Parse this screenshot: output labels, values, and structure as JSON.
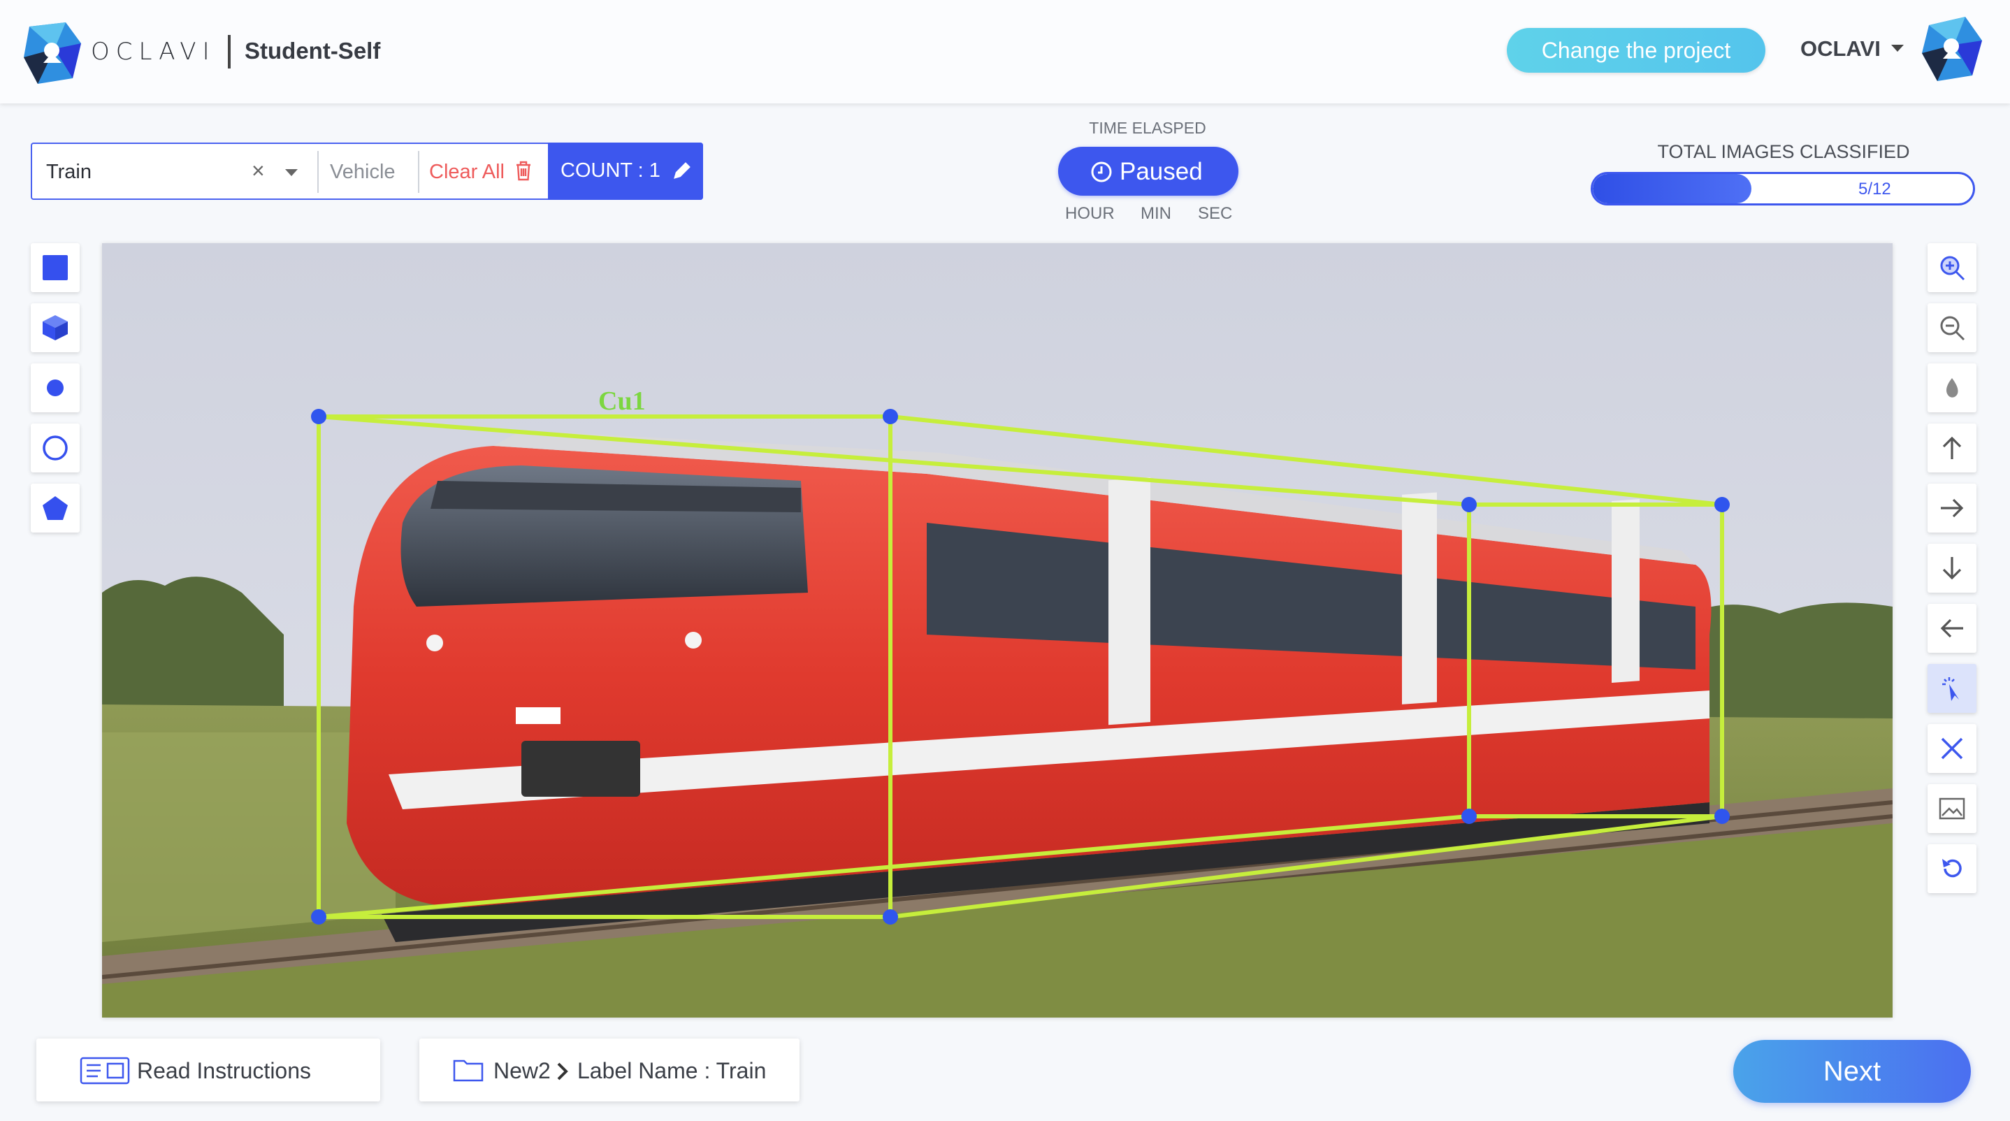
{
  "header": {
    "logo_text": "OCLAVI",
    "project_name": "Student-Self",
    "change_project_label": "Change the project",
    "user_name": "OCLAVI"
  },
  "label_bar": {
    "selected_label": "Train",
    "parent_label": "Vehicle",
    "clear_all_label": "Clear All",
    "count_label": "COUNT : 1"
  },
  "timer": {
    "title": "TIME ELASPED",
    "status": "Paused",
    "units": [
      "HOUR",
      "MIN",
      "SEC"
    ]
  },
  "progress": {
    "title": "TOTAL IMAGES CLASSIFIED",
    "text": "5/12",
    "fraction": 0.4167
  },
  "left_tools": [
    {
      "icon": "rectangle-tool-icon"
    },
    {
      "icon": "cuboid-tool-icon"
    },
    {
      "icon": "point-tool-icon"
    },
    {
      "icon": "circle-tool-icon"
    },
    {
      "icon": "polygon-tool-icon"
    }
  ],
  "right_tools": [
    {
      "icon": "zoom-in-icon",
      "active": true
    },
    {
      "icon": "zoom-out-icon",
      "active": false
    },
    {
      "icon": "brightness-icon",
      "active": false
    },
    {
      "icon": "arrow-up-icon",
      "active": false
    },
    {
      "icon": "arrow-right-icon",
      "active": false
    },
    {
      "icon": "arrow-down-icon",
      "active": false
    },
    {
      "icon": "arrow-left-icon",
      "active": false
    },
    {
      "icon": "select-cursor-icon",
      "active": true
    },
    {
      "icon": "close-icon",
      "active": false
    },
    {
      "icon": "image-icon",
      "active": false
    },
    {
      "icon": "undo-icon",
      "active": false
    }
  ],
  "annotation": {
    "label_text": "Cu1",
    "color": "#c6ee3c",
    "handle_color": "#2f55ee"
  },
  "footer": {
    "read_instructions_label": "Read Instructions",
    "breadcrumb_folder": "New2",
    "breadcrumb_label": "Label Name : Train",
    "next_label": "Next"
  },
  "colors": {
    "primary": "#3d57ee",
    "accent_cyan": "#5fd2ea",
    "danger": "#ee5b5b"
  }
}
